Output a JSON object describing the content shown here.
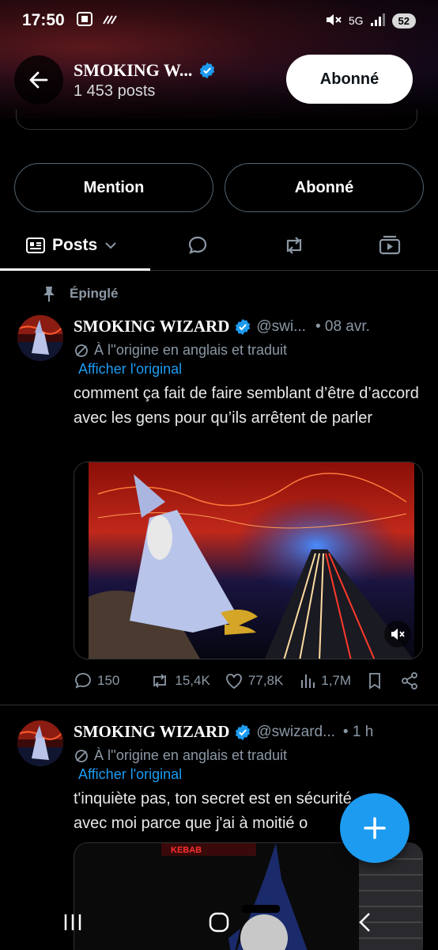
{
  "status_bar": {
    "time": "17:50",
    "network": "5G",
    "battery": "52"
  },
  "header": {
    "name": "SMOKING W...",
    "posts_count": "1 453 posts",
    "follow_label": "Abonné"
  },
  "actions": {
    "mention_label": "Mention",
    "follow_label": "Abonné"
  },
  "tabs": {
    "posts_label": "Posts"
  },
  "pinned": {
    "label": "Épinglé"
  },
  "posts": [
    {
      "name": "SMOKING WIZARD",
      "handle": "@swi...",
      "time": "• 08 avr.",
      "translated": "À l''origine en anglais et traduit",
      "show_original": "Afficher l'original",
      "text": "comment ça fait de faire semblant d’être d’accord avec les gens pour qu’ils arrêtent de parler",
      "stats": {
        "replies": "150",
        "reposts": "15,4K",
        "likes": "77,8K",
        "views": "1,7M"
      }
    },
    {
      "name": "SMOKING WIZARD",
      "handle": "@swizard...",
      "time": "• 1 h",
      "translated": "À l''origine en anglais et traduit",
      "show_original": "Afficher l'original",
      "text": "t'inquiète pas, ton secret est en sécurité avec moi parce que j'ai à moitié o",
      "sign_text": "KEBAB"
    }
  ],
  "colors": {
    "accent": "#1d9bf0",
    "background": "#000000",
    "muted": "#8b98a5",
    "border": "#2f3336"
  }
}
